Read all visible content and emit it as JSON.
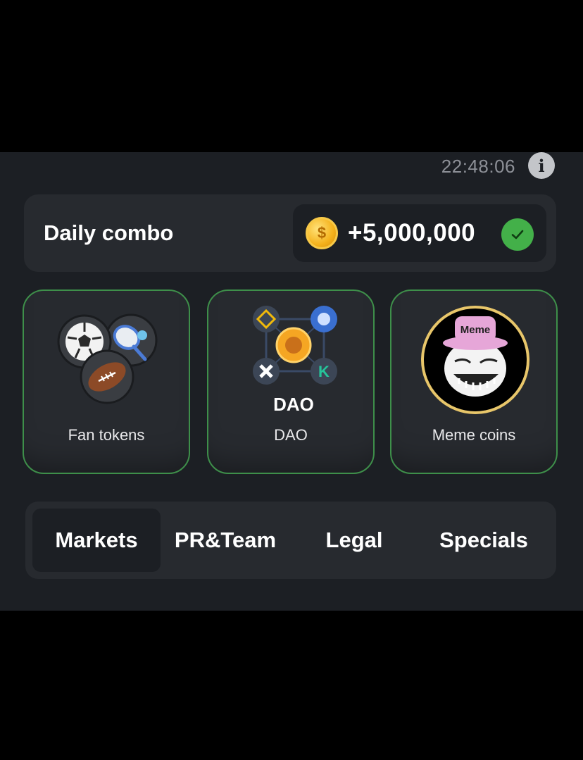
{
  "timer": "22:48:06",
  "combo": {
    "title": "Daily combo",
    "reward": "+5,000,000",
    "coin_symbol": "$"
  },
  "cards": [
    {
      "label": "Fan tokens",
      "icon": "fan-tokens-icon"
    },
    {
      "label": "DAO",
      "icon": "dao-icon",
      "art_text": "DAO"
    },
    {
      "label": "Meme coins",
      "icon": "meme-coins-icon",
      "art_text": "Meme"
    }
  ],
  "tabs": [
    {
      "label": "Markets",
      "active": true
    },
    {
      "label": "PR&Team",
      "active": false
    },
    {
      "label": "Legal",
      "active": false
    },
    {
      "label": "Specials",
      "active": false
    }
  ],
  "colors": {
    "background": "#1c1f24",
    "card": "#272a2f",
    "accent_border": "#3e8f4a",
    "check": "#43b049",
    "coin": "#f5b21c"
  }
}
